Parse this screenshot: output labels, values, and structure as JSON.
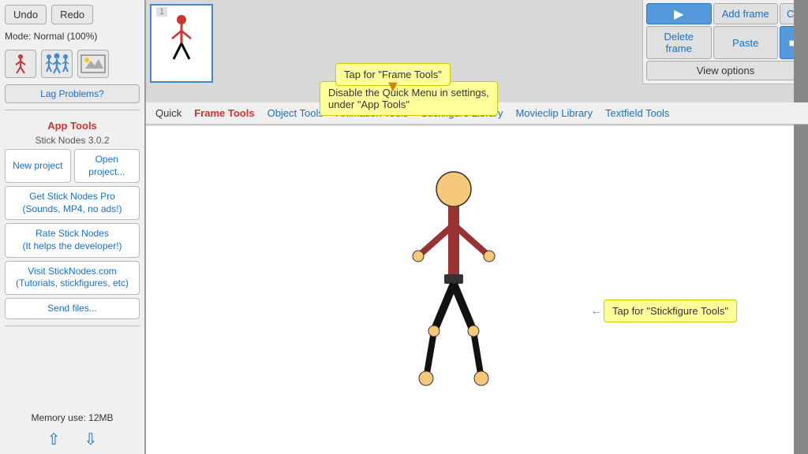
{
  "sidebar": {
    "undo_label": "Undo",
    "redo_label": "Redo",
    "mode_label": "Mode: Normal (100%)",
    "lag_btn": "Lag Problems?",
    "app_tools_title": "App Tools",
    "version": "Stick Nodes 3.0.2",
    "new_project": "New project",
    "open_project": "Open project...",
    "pro_btn": "Get Stick Nodes Pro\n(Sounds, MP4, no ads!)",
    "rate_btn": "Rate Stick Nodes\n(It helps the developer!)",
    "visit_btn": "Visit StickNodes.com\n(Tutorials, stickfigures, etc)",
    "send_files": "Send files...",
    "memory": "Memory use: 12MB"
  },
  "top_right": {
    "add_frame": "Add frame",
    "copy": "Copy",
    "delete_frame": "Delete frame",
    "paste": "Paste",
    "view_options": "View options"
  },
  "nav": {
    "tabs": [
      {
        "label": "Quick",
        "color": "normal"
      },
      {
        "label": "Frame Tools",
        "color": "red"
      },
      {
        "label": "Object Tools",
        "color": "blue"
      },
      {
        "label": "Animation Tools",
        "color": "blue"
      },
      {
        "label": "Stickfigure Library",
        "color": "blue"
      },
      {
        "label": "Movieclip Library",
        "color": "blue"
      },
      {
        "label": "Textfield Tools",
        "color": "blue"
      }
    ]
  },
  "tooltips": {
    "frame_tools": "Tap for \"Frame Tools\"",
    "disable_quick": "Disable the Quick Menu in settings,\nunder \"App Tools\"",
    "stickfig_tools": "Tap for \"Stickfigure Tools\""
  },
  "frame": {
    "number": "1"
  }
}
